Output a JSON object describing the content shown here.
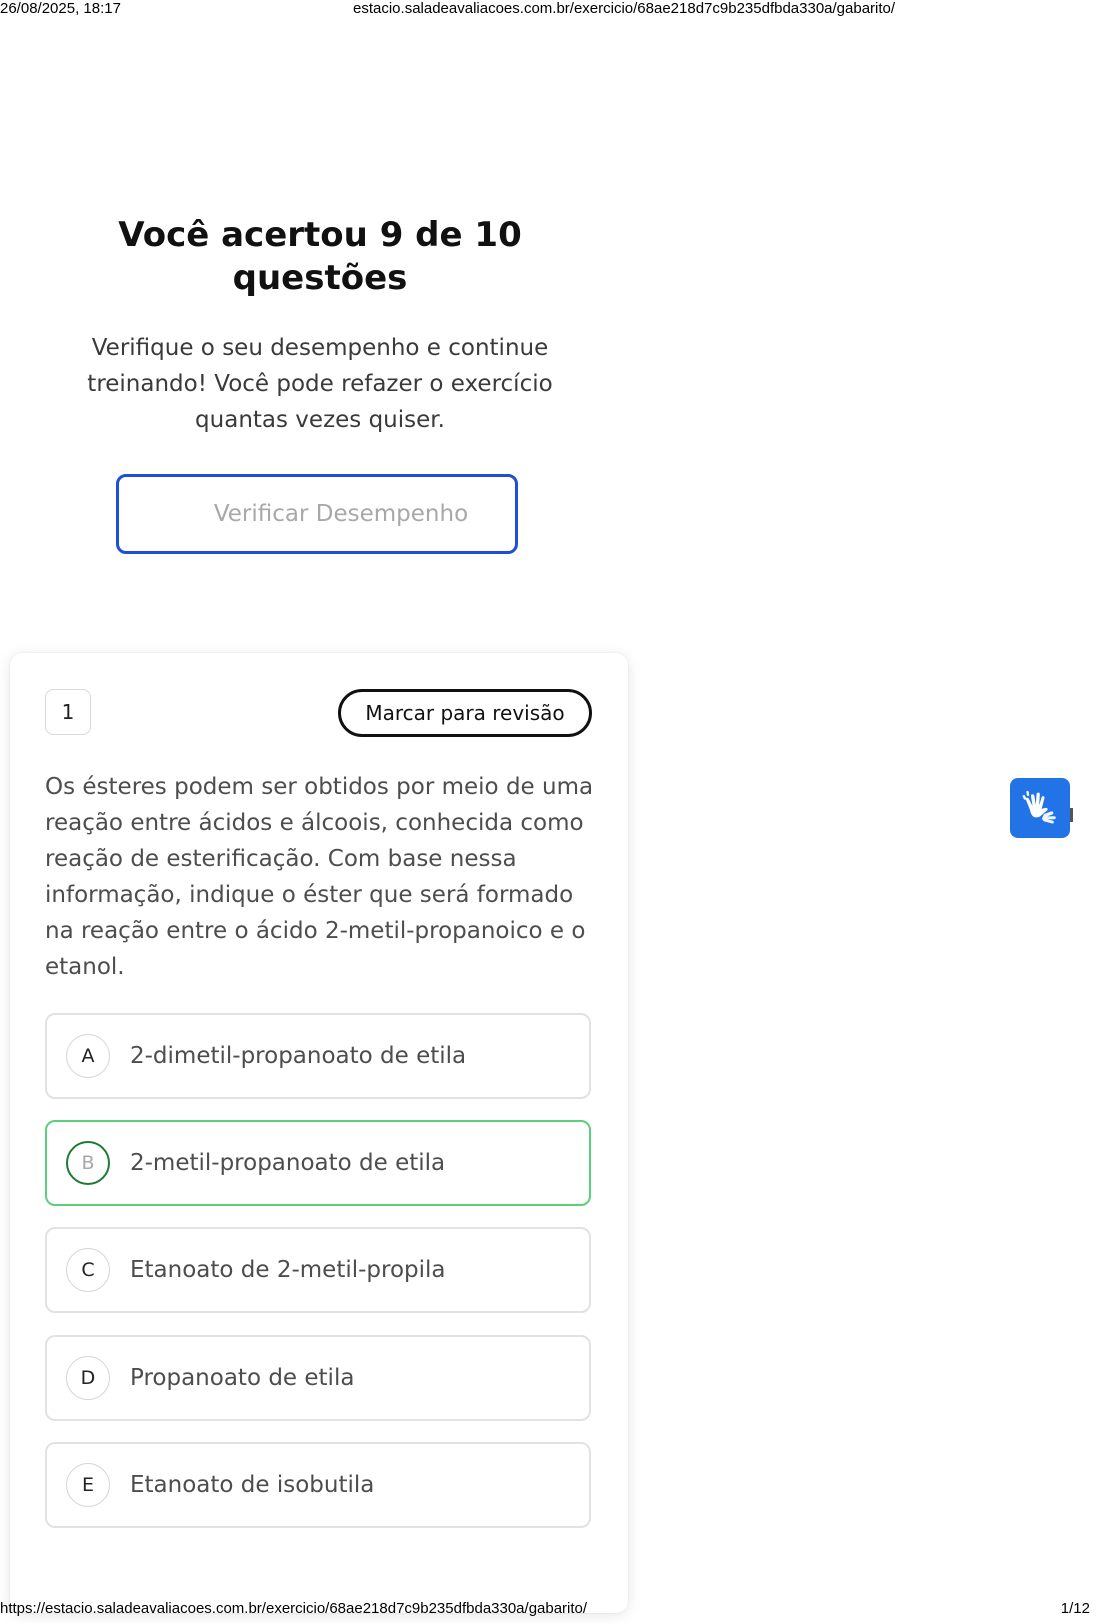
{
  "print_header": {
    "datetime": "26/08/2025, 18:17",
    "url": "estacio.saladeavaliacoes.com.br/exercicio/68ae218d7c9b235dfbda330a/gabarito/"
  },
  "print_footer": {
    "url": "https://estacio.saladeavaliacoes.com.br/exercicio/68ae218d7c9b235dfbda330a/gabarito/",
    "page": "1/12"
  },
  "result": {
    "title": "Você acertou 9 de 10 questões",
    "subtitle": "Verifique o seu desempenho e continue treinando! Você pode refazer o exercício quantas vezes quiser.",
    "verify_button": "Verificar Desempenho"
  },
  "question": {
    "number": "1",
    "review_button": "Marcar para revisão",
    "text": "Os ésteres podem ser obtidos por meio de uma reação entre ácidos e álcoois, conhecida como reação de esterificação. Com base nessa informação, indique o éster que será formado na reação entre o ácido 2-metil-propanoico e o etanol.",
    "correct_letter": "B",
    "options": [
      {
        "letter": "A",
        "text": "2-dimetil-propanoato de etila"
      },
      {
        "letter": "B",
        "text": "2-metil-propanoato de etila"
      },
      {
        "letter": "C",
        "text": "Etanoato de 2-metil-propila"
      },
      {
        "letter": "D",
        "text": "Propanoato de etila"
      },
      {
        "letter": "E",
        "text": "Etanoato de isobutila"
      }
    ]
  },
  "accessibility_widget": {
    "icon": "sign-language-icon",
    "color": "#2273e6"
  },
  "colors": {
    "primary_border": "#1d4fd8",
    "correct_border": "#5bd07a"
  }
}
